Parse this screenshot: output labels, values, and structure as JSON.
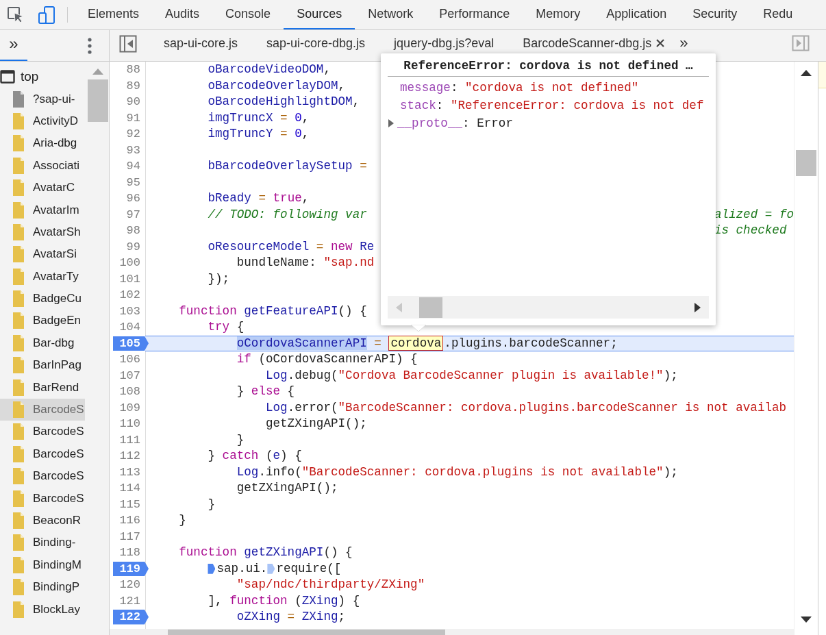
{
  "toolbar": {
    "tabs": [
      {
        "label": "Elements",
        "selected": false
      },
      {
        "label": "Audits",
        "selected": false
      },
      {
        "label": "Console",
        "selected": false
      },
      {
        "label": "Sources",
        "selected": true
      },
      {
        "label": "Network",
        "selected": false
      },
      {
        "label": "Performance",
        "selected": false
      },
      {
        "label": "Memory",
        "selected": false
      },
      {
        "label": "Application",
        "selected": false
      },
      {
        "label": "Security",
        "selected": false
      },
      {
        "label": "Redu",
        "selected": false
      }
    ]
  },
  "navigator": {
    "more_tabs": "»",
    "frame": "top",
    "items": [
      {
        "label": "?sap-ui-",
        "kind": "document",
        "selected": false
      },
      {
        "label": "ActivityD",
        "kind": "script",
        "selected": false
      },
      {
        "label": "Aria-dbg",
        "kind": "script",
        "selected": false
      },
      {
        "label": "Associati",
        "kind": "script",
        "selected": false
      },
      {
        "label": "AvatarC",
        "kind": "script",
        "selected": false
      },
      {
        "label": "AvatarIm",
        "kind": "script",
        "selected": false
      },
      {
        "label": "AvatarSh",
        "kind": "script",
        "selected": false
      },
      {
        "label": "AvatarSi",
        "kind": "script",
        "selected": false
      },
      {
        "label": "AvatarTy",
        "kind": "script",
        "selected": false
      },
      {
        "label": "BadgeCu",
        "kind": "script",
        "selected": false
      },
      {
        "label": "BadgeEn",
        "kind": "script",
        "selected": false
      },
      {
        "label": "Bar-dbg",
        "kind": "script",
        "selected": false
      },
      {
        "label": "BarInPag",
        "kind": "script",
        "selected": false
      },
      {
        "label": "BarRend",
        "kind": "script",
        "selected": false
      },
      {
        "label": "BarcodeS",
        "kind": "script",
        "selected": true
      },
      {
        "label": "BarcodeS",
        "kind": "script",
        "selected": false
      },
      {
        "label": "BarcodeS",
        "kind": "script",
        "selected": false
      },
      {
        "label": "BarcodeS",
        "kind": "script",
        "selected": false
      },
      {
        "label": "BarcodeS",
        "kind": "script",
        "selected": false
      },
      {
        "label": "BeaconR",
        "kind": "script",
        "selected": false
      },
      {
        "label": "Binding-",
        "kind": "script",
        "selected": false
      },
      {
        "label": "BindingM",
        "kind": "script",
        "selected": false
      },
      {
        "label": "BindingP",
        "kind": "script",
        "selected": false
      },
      {
        "label": "BlockLay",
        "kind": "script",
        "selected": false
      }
    ]
  },
  "editor": {
    "more_tabs": "»",
    "tabs": [
      {
        "label": "sap-ui-core.js",
        "closable": false
      },
      {
        "label": "sap-ui-core-dbg.js",
        "closable": false
      },
      {
        "label": "jquery-dbg.js?eval",
        "closable": false
      },
      {
        "label": "BarcodeScanner-dbg.js",
        "closable": true
      }
    ],
    "lines": [
      {
        "number": "88",
        "breakpoint": false,
        "current": false,
        "tokens": [
          {
            "kind": "variable",
            "text": "        oBarcodeVideoDOM"
          },
          {
            "kind": "text",
            "text": ","
          }
        ]
      },
      {
        "number": "89",
        "breakpoint": false,
        "current": false,
        "tokens": [
          {
            "kind": "variable",
            "text": "        oBarcodeOverlayDOM"
          },
          {
            "kind": "text",
            "text": ","
          }
        ]
      },
      {
        "number": "90",
        "breakpoint": false,
        "current": false,
        "tokens": [
          {
            "kind": "variable",
            "text": "        oBarcodeHighlightDOM"
          },
          {
            "kind": "text",
            "text": ","
          }
        ]
      },
      {
        "number": "91",
        "breakpoint": false,
        "current": false,
        "tokens": [
          {
            "kind": "variable",
            "text": "        imgTruncX"
          },
          {
            "kind": "operator",
            "text": " = "
          },
          {
            "kind": "number",
            "text": "0"
          },
          {
            "kind": "text",
            "text": ","
          }
        ]
      },
      {
        "number": "92",
        "breakpoint": false,
        "current": false,
        "tokens": [
          {
            "kind": "variable",
            "text": "        imgTruncY"
          },
          {
            "kind": "operator",
            "text": " = "
          },
          {
            "kind": "number",
            "text": "0"
          },
          {
            "kind": "text",
            "text": ","
          }
        ]
      },
      {
        "number": "93",
        "breakpoint": false,
        "current": false
      },
      {
        "number": "94",
        "breakpoint": false,
        "current": false,
        "tokens": [
          {
            "kind": "variable",
            "text": "        bBarcodeOverlaySetup"
          },
          {
            "kind": "operator",
            "text": " ="
          }
        ]
      },
      {
        "number": "95",
        "breakpoint": false,
        "current": false
      },
      {
        "number": "96",
        "breakpoint": false,
        "current": false,
        "tokens": [
          {
            "kind": "variable",
            "text": "        bReady"
          },
          {
            "kind": "operator",
            "text": " = "
          },
          {
            "kind": "keyword",
            "text": "true"
          },
          {
            "kind": "text",
            "text": ","
          }
        ]
      },
      {
        "number": "97",
        "breakpoint": false,
        "current": false,
        "tokens": [
          {
            "kind": "comment",
            "text": "        // TODO: following var"
          }
        ],
        "tail": [
          {
            "kind": "comment",
            "text": "alized = fo"
          }
        ]
      },
      {
        "number": "98",
        "breakpoint": false,
        "current": false,
        "tail": [
          {
            "kind": "comment",
            "text": "is checked"
          }
        ]
      },
      {
        "number": "99",
        "breakpoint": false,
        "current": false,
        "tokens": [
          {
            "kind": "variable",
            "text": "        oResourceModel"
          },
          {
            "kind": "operator",
            "text": " = "
          },
          {
            "kind": "keyword",
            "text": "new"
          },
          {
            "kind": "variable",
            "text": " Re"
          }
        ]
      },
      {
        "number": "100",
        "breakpoint": false,
        "current": false,
        "tokens": [
          {
            "kind": "text",
            "text": "            bundleName: "
          },
          {
            "kind": "string",
            "text": "\"sap.nd"
          }
        ]
      },
      {
        "number": "101",
        "breakpoint": false,
        "current": false,
        "tokens": [
          {
            "kind": "text",
            "text": "        });"
          }
        ]
      },
      {
        "number": "102",
        "breakpoint": false,
        "current": false
      },
      {
        "number": "103",
        "breakpoint": false,
        "current": false,
        "tokens": [
          {
            "kind": "keyword",
            "text": "    function"
          },
          {
            "kind": "variable",
            "text": " getFeatureAPI"
          },
          {
            "kind": "text",
            "text": "() {"
          }
        ]
      },
      {
        "number": "104",
        "breakpoint": false,
        "current": false,
        "tokens": [
          {
            "kind": "keyword",
            "text": "        try"
          },
          {
            "kind": "text",
            "text": " {"
          }
        ]
      },
      {
        "number": "105",
        "breakpoint": true,
        "current": true,
        "tokens": [
          {
            "kind": "selection",
            "text": "            oCordovaScannerAPI"
          },
          {
            "kind": "operator",
            "text": " = "
          },
          {
            "kind": "evaluated",
            "text": "cordova"
          },
          {
            "kind": "text",
            "text": ".plugins.barcodeScanner;"
          }
        ]
      },
      {
        "number": "106",
        "breakpoint": false,
        "current": false,
        "tokens": [
          {
            "kind": "keyword",
            "text": "            if"
          },
          {
            "kind": "text",
            "text": " (oCordovaScannerAPI) {"
          }
        ]
      },
      {
        "number": "107",
        "breakpoint": false,
        "current": false,
        "tokens": [
          {
            "kind": "variable",
            "text": "                Log"
          },
          {
            "kind": "text",
            "text": ".debug("
          },
          {
            "kind": "string",
            "text": "\"Cordova BarcodeScanner plugin is available!\""
          },
          {
            "kind": "text",
            "text": ");"
          }
        ]
      },
      {
        "number": "108",
        "breakpoint": false,
        "current": false,
        "tokens": [
          {
            "kind": "text",
            "text": "            } "
          },
          {
            "kind": "keyword",
            "text": "else"
          },
          {
            "kind": "text",
            "text": " {"
          }
        ]
      },
      {
        "number": "109",
        "breakpoint": false,
        "current": false,
        "tokens": [
          {
            "kind": "variable",
            "text": "                Log"
          },
          {
            "kind": "text",
            "text": ".error("
          },
          {
            "kind": "string",
            "text": "\"BarcodeScanner: cordova.plugins.barcodeScanner is not availab"
          }
        ]
      },
      {
        "number": "110",
        "breakpoint": false,
        "current": false,
        "tokens": [
          {
            "kind": "text",
            "text": "                getZXingAPI();"
          }
        ]
      },
      {
        "number": "111",
        "breakpoint": false,
        "current": false,
        "tokens": [
          {
            "kind": "text",
            "text": "            }"
          }
        ]
      },
      {
        "number": "112",
        "breakpoint": false,
        "current": false,
        "tokens": [
          {
            "kind": "text",
            "text": "        } "
          },
          {
            "kind": "keyword",
            "text": "catch"
          },
          {
            "kind": "text",
            "text": " ("
          },
          {
            "kind": "variable",
            "text": "e"
          },
          {
            "kind": "text",
            "text": ") {"
          }
        ]
      },
      {
        "number": "113",
        "breakpoint": false,
        "current": false,
        "tokens": [
          {
            "kind": "variable",
            "text": "            Log"
          },
          {
            "kind": "text",
            "text": ".info("
          },
          {
            "kind": "string",
            "text": "\"BarcodeScanner: cordova.plugins is not available\""
          },
          {
            "kind": "text",
            "text": ");"
          }
        ]
      },
      {
        "number": "114",
        "breakpoint": false,
        "current": false,
        "tokens": [
          {
            "kind": "text",
            "text": "            getZXingAPI();"
          }
        ]
      },
      {
        "number": "115",
        "breakpoint": false,
        "current": false,
        "tokens": [
          {
            "kind": "text",
            "text": "        }"
          }
        ]
      },
      {
        "number": "116",
        "breakpoint": false,
        "current": false,
        "tokens": [
          {
            "kind": "text",
            "text": "    }"
          }
        ]
      },
      {
        "number": "117",
        "breakpoint": false,
        "current": false
      },
      {
        "number": "118",
        "breakpoint": false,
        "current": false,
        "tokens": [
          {
            "kind": "keyword",
            "text": "    function"
          },
          {
            "kind": "variable",
            "text": " getZXingAPI"
          },
          {
            "kind": "text",
            "text": "() {"
          }
        ]
      },
      {
        "number": "119",
        "breakpoint": true,
        "current": false,
        "tokens": [
          {
            "kind": "marker",
            "active": true
          },
          {
            "kind": "text",
            "text": "sap.ui."
          },
          {
            "kind": "marker",
            "active": false
          },
          {
            "kind": "text",
            "text": "require(["
          }
        ]
      },
      {
        "number": "120",
        "breakpoint": false,
        "current": false,
        "tokens": [
          {
            "kind": "string",
            "text": "            \"sap/ndc/thirdparty/ZXing\""
          }
        ]
      },
      {
        "number": "121",
        "breakpoint": false,
        "current": false,
        "tokens": [
          {
            "kind": "text",
            "text": "        ], "
          },
          {
            "kind": "keyword",
            "text": "function"
          },
          {
            "kind": "text",
            "text": " ("
          },
          {
            "kind": "variable",
            "text": "ZXing"
          },
          {
            "kind": "text",
            "text": ") {"
          }
        ]
      },
      {
        "number": "122",
        "breakpoint": true,
        "current": false,
        "tokens": [
          {
            "kind": "variable",
            "text": "            oZXing"
          },
          {
            "kind": "operator",
            "text": " = "
          },
          {
            "kind": "variable",
            "text": "ZXing"
          },
          {
            "kind": "text",
            "text": ";"
          }
        ]
      }
    ],
    "popover": {
      "title": "ReferenceError: cordova is not defined …",
      "properties": [
        {
          "expandable": false,
          "tokens": [
            {
              "kind": "property",
              "text": "message"
            },
            {
              "kind": "text",
              "text": ": "
            },
            {
              "kind": "string",
              "text": "\"cordova is not defined\""
            }
          ]
        },
        {
          "expandable": false,
          "tokens": [
            {
              "kind": "property",
              "text": "stack"
            },
            {
              "kind": "text",
              "text": ": "
            },
            {
              "kind": "string",
              "text": "\"ReferenceError: cordova is not def"
            }
          ]
        },
        {
          "expandable": true,
          "tokens": [
            {
              "kind": "property",
              "text": "__proto__"
            },
            {
              "kind": "text",
              "text": ": Error"
            }
          ]
        }
      ]
    }
  }
}
